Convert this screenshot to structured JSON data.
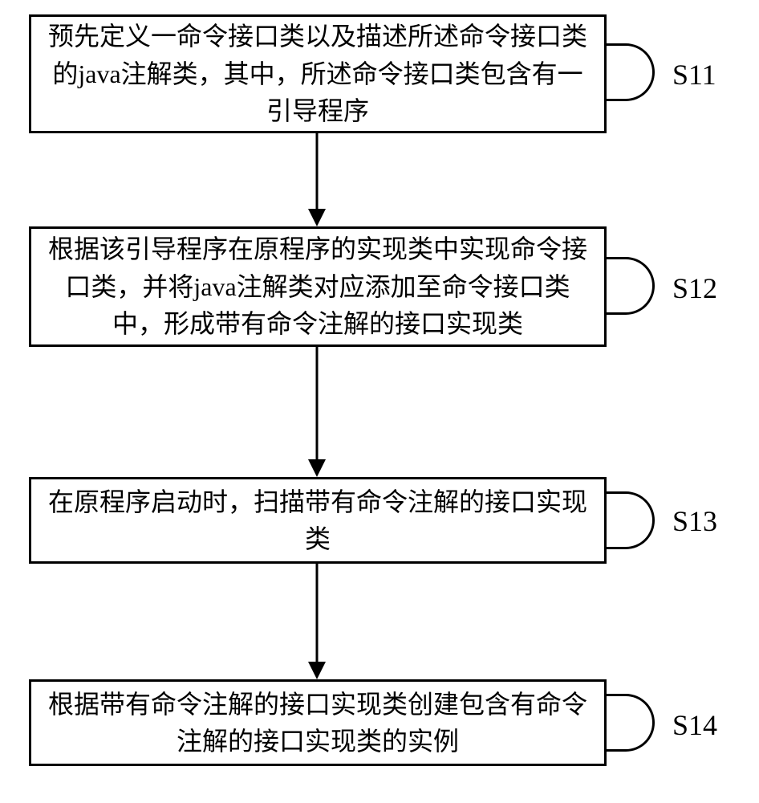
{
  "steps": {
    "s11": {
      "text": "预先定义一命令接口类以及描述所述命令接口类的java注解类，其中，所述命令接口类包含有一引导程序",
      "label": "S11"
    },
    "s12": {
      "text": "根据该引导程序在原程序的实现类中实现命令接口类，并将java注解类对应添加至命令接口类中，形成带有命令注解的接口实现类",
      "label": "S12"
    },
    "s13": {
      "text": "在原程序启动时，扫描带有命令注解的接口实现类",
      "label": "S13"
    },
    "s14": {
      "text": "根据带有命令注解的接口实现类创建包含有命令注解的接口实现类的实例",
      "label": "S14"
    }
  }
}
